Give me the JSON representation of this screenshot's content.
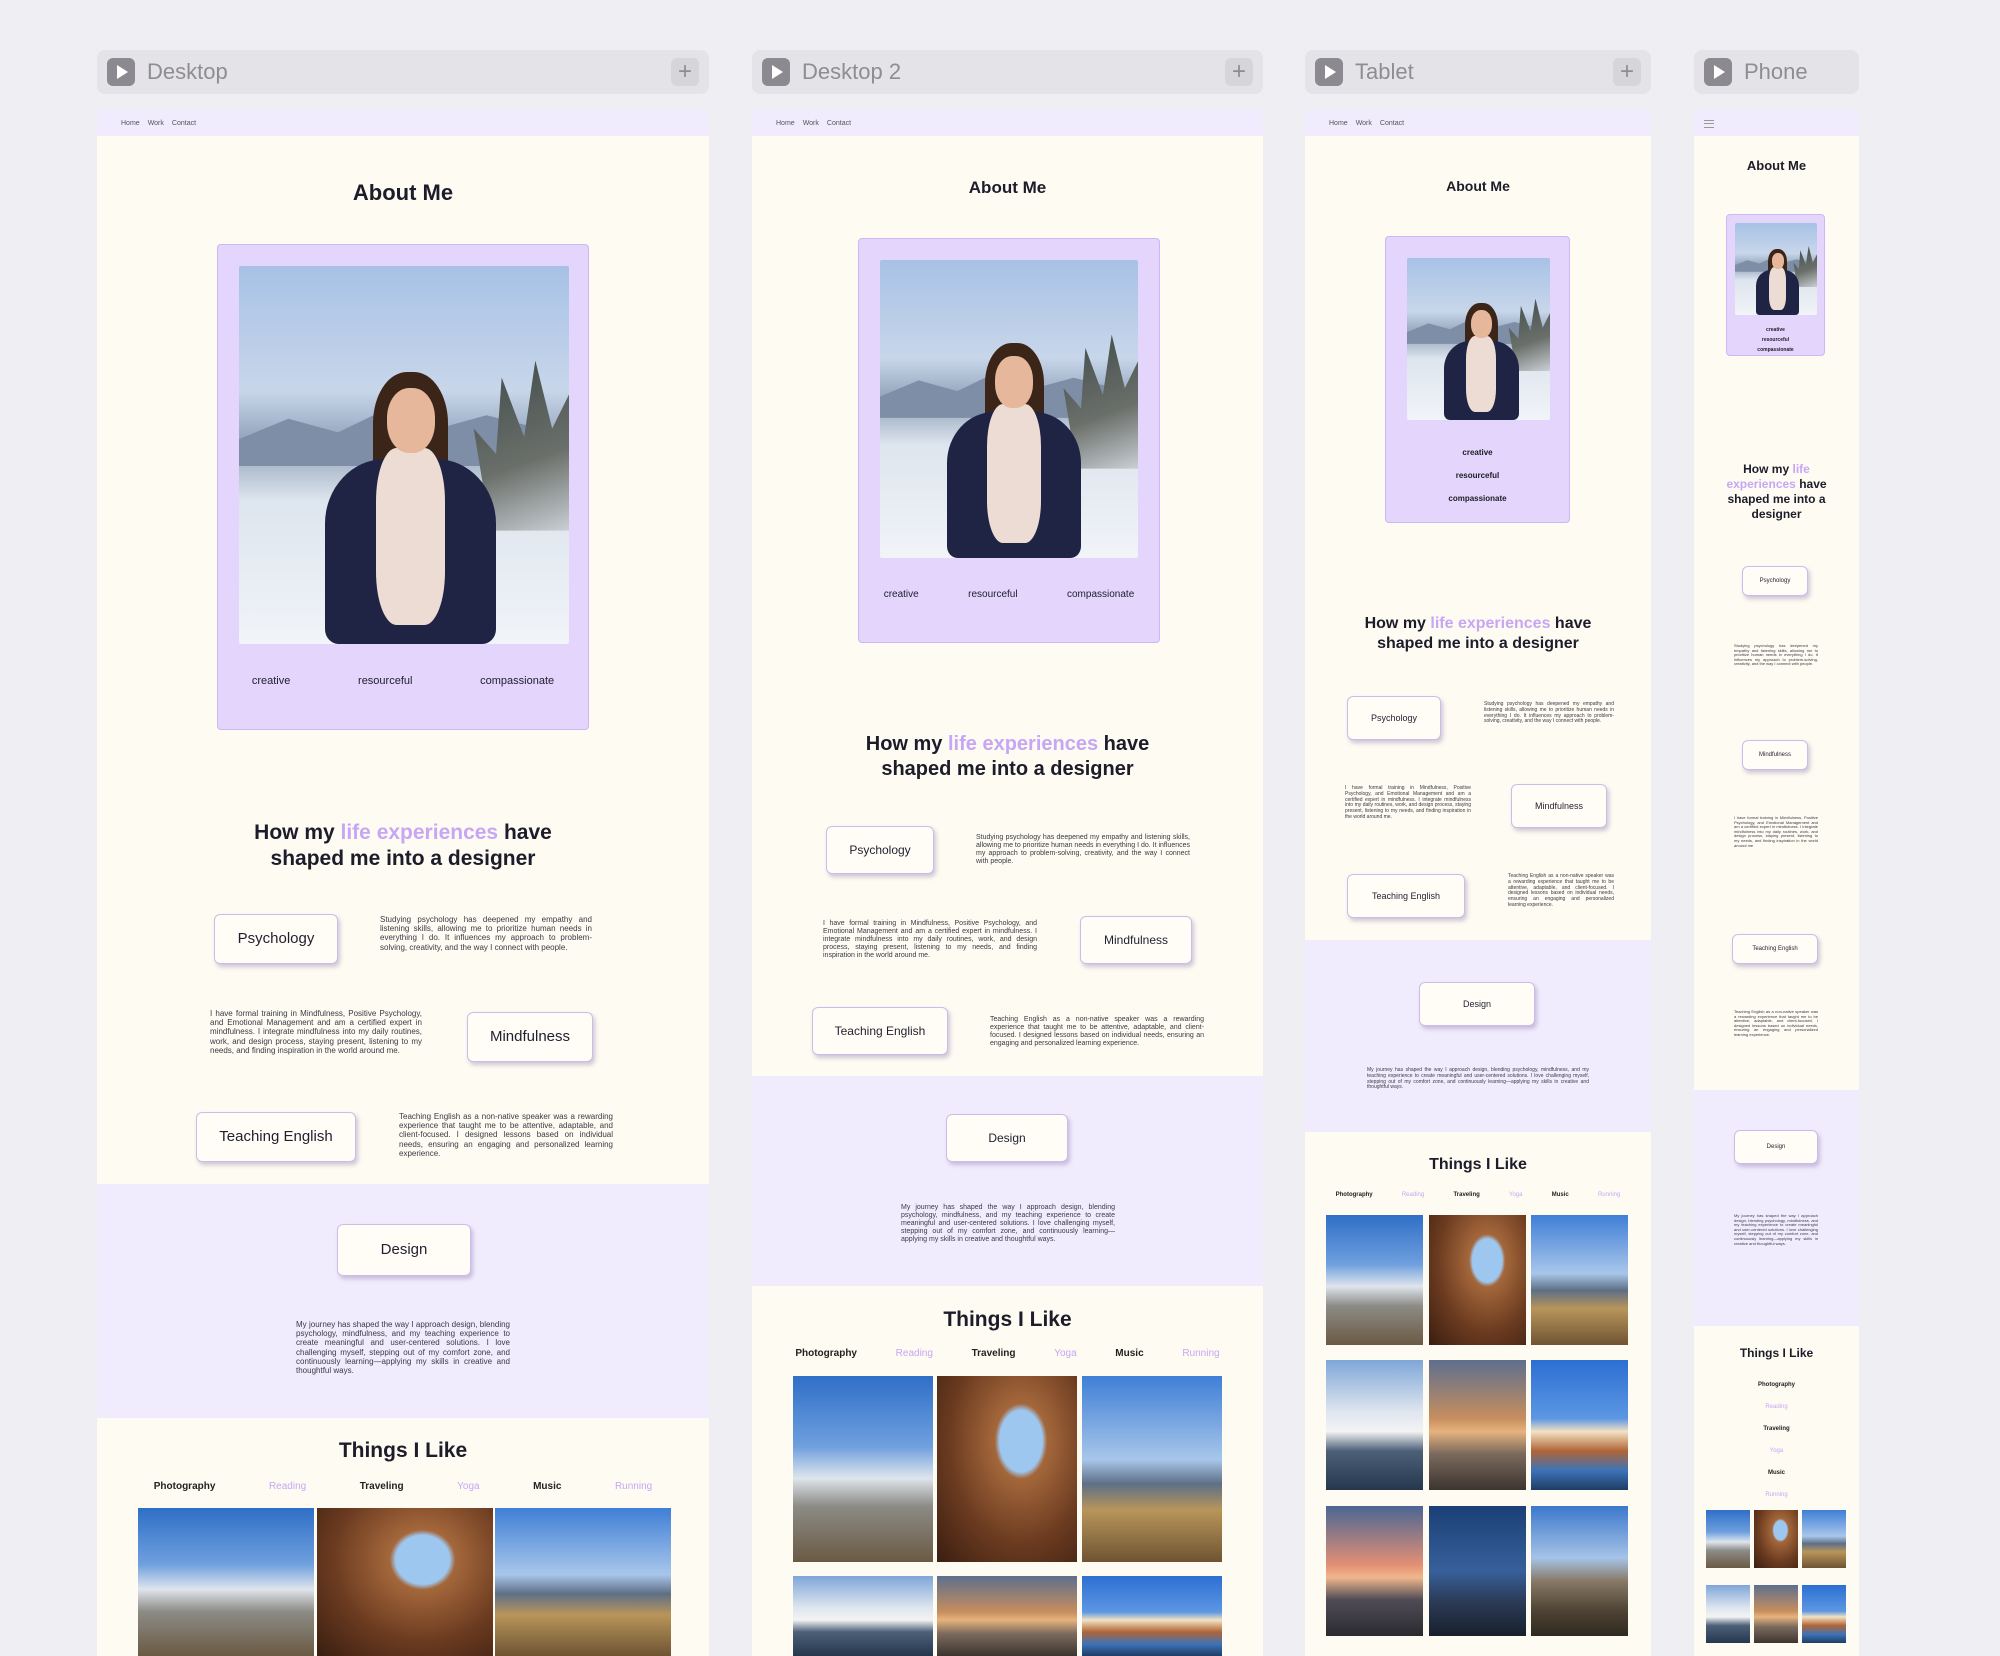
{
  "nav": {
    "home": "Home",
    "work": "Work",
    "contact": "Contact"
  },
  "frames": {
    "desktop": {
      "label": "Desktop"
    },
    "desktop2": {
      "label": "Desktop 2"
    },
    "tablet": {
      "label": "Tablet"
    },
    "phone": {
      "label": "Phone"
    }
  },
  "about": {
    "title": "About Me",
    "traits": [
      "creative",
      "resourceful",
      "compassionate"
    ],
    "photo_alt": "Portrait in a snowy mountain landscape"
  },
  "experiences": {
    "heading_pre": "How my",
    "heading_highlight": "life experiences",
    "heading_post": "have",
    "heading_line2": "shaped me into a designer",
    "phone_heading_line2": "shaped me into a designer",
    "items": [
      {
        "label": "Psychology",
        "text": "Studying psychology has deepened my empathy and listening skills, allowing me to prioritize human needs in everything I do. It influences my approach to problem-solving, creativity, and the way I connect with people."
      },
      {
        "label": "Mindfulness",
        "text": "I have formal training in Mindfulness, Positive Psychology, and Emotional Management and am a certified expert in mindfulness. I integrate mindfulness into my daily routines, work, and design process, staying present, listening to my needs, and finding inspiration in the world around me."
      },
      {
        "label": "Teaching English",
        "text": "Teaching English as a non-native speaker was a rewarding experience that taught me to be attentive, adaptable, and client-focused. I designed lessons based on individual needs, ensuring an engaging and personalized learning experience."
      }
    ]
  },
  "design": {
    "label": "Design",
    "text": "My journey has shaped the way I approach design, blending psychology, mindfulness, and my teaching experience to create meaningful and user-centered solutions. I love challenging myself, stepping out of my comfort zone, and continuously learning—applying my skills in creative and thoughtful ways."
  },
  "things": {
    "title": "Things I Like",
    "tabs": [
      {
        "label": "Photography",
        "active": true
      },
      {
        "label": "Reading",
        "active": false
      },
      {
        "label": "Traveling",
        "active": true
      },
      {
        "label": "Yoga",
        "active": false
      },
      {
        "label": "Music",
        "active": true
      },
      {
        "label": "Running",
        "active": false
      }
    ]
  },
  "colors": {
    "accent": "#c8a6f6",
    "card": "#e3d5fc",
    "band": "#f1ecfd",
    "page": "#fdfbf2"
  }
}
